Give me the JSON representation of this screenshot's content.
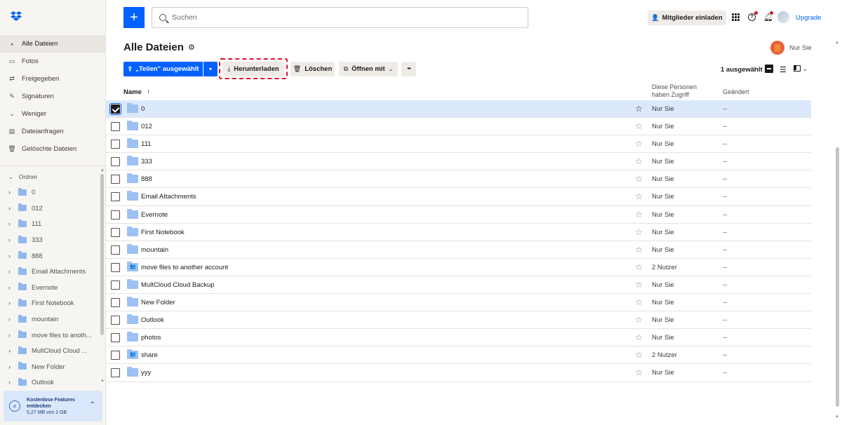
{
  "sidebar": {
    "nav": [
      {
        "label": "Alle Dateien",
        "icon": "files-icon",
        "active": true
      },
      {
        "label": "Fotos",
        "icon": "photos-icon"
      },
      {
        "label": "Freigegeben",
        "icon": "shared-icon"
      },
      {
        "label": "Signaturen",
        "icon": "signature-icon"
      },
      {
        "label": "Weniger",
        "icon": "chevron-down-icon"
      },
      {
        "label": "Dateianfragen",
        "icon": "file-request-icon"
      },
      {
        "label": "Gelöschte Dateien",
        "icon": "trash-icon"
      }
    ],
    "folders_heading": "Ordner",
    "folders": [
      "0",
      "012",
      "111",
      "333",
      "888",
      "Email Attachments",
      "Evernote",
      "First Notebook",
      "mountain",
      "move files to anoth...",
      "MultCloud Cloud ...",
      "New Folder",
      "Outlook"
    ],
    "promo": {
      "title": "Kostenlose Features entdecken",
      "storage": "5,27 MB von 2 GB"
    }
  },
  "topbar": {
    "search_placeholder": "Suchen",
    "invite_label": "Mitglieder einladen",
    "upgrade_label": "Upgrade"
  },
  "page": {
    "title": "Alle Dateien",
    "owner_label": "Nur Sie"
  },
  "toolbar": {
    "share_label": "„Teilen\" ausgewählt",
    "download_label": "Herunterladen",
    "delete_label": "Löschen",
    "open_label": "Öffnen mit",
    "more_label": "•••",
    "selected_count": "1 ausgewählt"
  },
  "table": {
    "columns": {
      "name": "Name",
      "access": "Diese Personen haben Zugriff",
      "changed": "Geändert"
    },
    "rows": [
      {
        "name": "0",
        "access": "Nur Sie",
        "changed": "--",
        "selected": true,
        "shared": false
      },
      {
        "name": "012",
        "access": "Nur Sie",
        "changed": "--",
        "selected": false,
        "shared": false
      },
      {
        "name": "111",
        "access": "Nur Sie",
        "changed": "--",
        "selected": false,
        "shared": false
      },
      {
        "name": "333",
        "access": "Nur Sie",
        "changed": "--",
        "selected": false,
        "shared": false
      },
      {
        "name": "888",
        "access": "Nur Sie",
        "changed": "--",
        "selected": false,
        "shared": false
      },
      {
        "name": "Email Attachments",
        "access": "Nur Sie",
        "changed": "--",
        "selected": false,
        "shared": false
      },
      {
        "name": "Evernote",
        "access": "Nur Sie",
        "changed": "--",
        "selected": false,
        "shared": false
      },
      {
        "name": "First Notebook",
        "access": "Nur Sie",
        "changed": "--",
        "selected": false,
        "shared": false
      },
      {
        "name": "mountain",
        "access": "Nur Sie",
        "changed": "--",
        "selected": false,
        "shared": false
      },
      {
        "name": "move files to another account",
        "access": "2 Nutzer",
        "changed": "--",
        "selected": false,
        "shared": true
      },
      {
        "name": "MultCloud Cloud Backup",
        "access": "Nur Sie",
        "changed": "--",
        "selected": false,
        "shared": false
      },
      {
        "name": "New Folder",
        "access": "Nur Sie",
        "changed": "--",
        "selected": false,
        "shared": false
      },
      {
        "name": "Outlook",
        "access": "Nur Sie",
        "changed": "--",
        "selected": false,
        "shared": false
      },
      {
        "name": "photos",
        "access": "Nur Sie",
        "changed": "--",
        "selected": false,
        "shared": false
      },
      {
        "name": "share",
        "access": "2 Nutzer",
        "changed": "--",
        "selected": false,
        "shared": true
      },
      {
        "name": "yyy",
        "access": "Nur Sie",
        "changed": "--",
        "selected": false,
        "shared": false
      }
    ]
  },
  "colors": {
    "accent": "#0061fe",
    "highlight": "#e0102a",
    "selected_row": "#dce8fc",
    "folder": "#9cc1f2"
  }
}
